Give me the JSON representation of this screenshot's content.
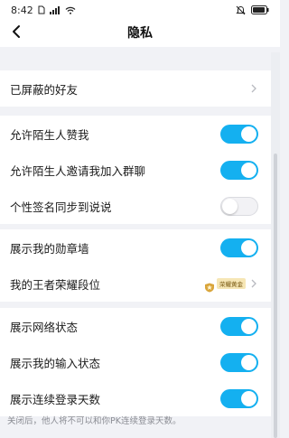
{
  "status_bar": {
    "time": "8:42",
    "icons": [
      "sim-icon",
      "signal-icon",
      "wifi-icon",
      "mute-icon",
      "battery-icon"
    ]
  },
  "nav": {
    "back_icon": "back-arrow-icon",
    "title": "隐私"
  },
  "sections": {
    "blocked": {
      "label": "已屏蔽的好友"
    },
    "stranger": {
      "like_label": "允许陌生人赞我",
      "like_on": true,
      "invite_label": "允许陌生人邀请我加入群聊",
      "invite_on": true,
      "signature_label": "个性签名同步到说说",
      "signature_on": false
    },
    "badges": {
      "medal_label": "展示我的勋章墙",
      "medal_on": true,
      "king_label": "我的王者荣耀段位",
      "king_rank_text": "荣耀黄金"
    },
    "status": {
      "network_label": "展示网络状态",
      "network_on": true,
      "typing_label": "展示我的输入状态",
      "typing_on": true,
      "streak_label": "展示连续登录天数",
      "streak_on": true
    }
  },
  "footer_note": "关闭后，他人将不可以和你PK连续登录天数。",
  "colors": {
    "toggle_on": "#14b0f0",
    "background": "#f1f2f6"
  }
}
